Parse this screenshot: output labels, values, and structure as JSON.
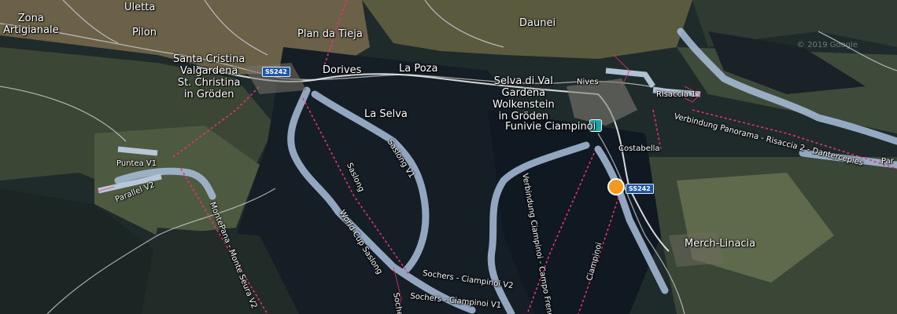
{
  "map": {
    "places": [
      {
        "id": "zona",
        "text": "Zona\nArtigianale"
      },
      {
        "id": "uletta",
        "text": "Uletta"
      },
      {
        "id": "pilon",
        "text": "Pilon"
      },
      {
        "id": "plan",
        "text": "Plan da Tieja"
      },
      {
        "id": "daunei",
        "text": "Daunei"
      },
      {
        "id": "santa",
        "text": "Santa Cristina\nValgardena\nSt. Christina\nin Gröden"
      },
      {
        "id": "dorives",
        "text": "Dorives"
      },
      {
        "id": "lapoza",
        "text": "La Poza"
      },
      {
        "id": "selvaval",
        "text": "Selva di Val\nGardena\nWolkenstein\nin Gröden"
      },
      {
        "id": "nives",
        "text": "Nives"
      },
      {
        "id": "laselva",
        "text": "La Selva"
      },
      {
        "id": "funivie",
        "text": "Funivie Ciampinoi"
      },
      {
        "id": "costabella",
        "text": "Costabella"
      },
      {
        "id": "merch",
        "text": "Merch-Linacia"
      }
    ],
    "pistes": [
      {
        "id": "risaccia1",
        "text": "Risaccia 1"
      },
      {
        "id": "verbpanorama",
        "text": "Verbindung Panorama - Risaccia 2 - Dantercepies"
      },
      {
        "id": "par",
        "text": "Par"
      },
      {
        "id": "puntea",
        "text": "Puntea V1"
      },
      {
        "id": "parallel",
        "text": "Parallel V2"
      },
      {
        "id": "montepana",
        "text": "MontePana - Monte Seura V2"
      },
      {
        "id": "saslong",
        "text": "Saslong"
      },
      {
        "id": "saslongv1",
        "text": "Saslong V1"
      },
      {
        "id": "worldcup",
        "text": "World Cup Saslong"
      },
      {
        "id": "verbciampinoi",
        "text": "Verbindung Ciampinoi - Campo Freno"
      },
      {
        "id": "ciampinoi",
        "text": "Ciampinoi"
      },
      {
        "id": "sochers2",
        "text": "Sochers - Ciampinoi V2"
      },
      {
        "id": "sochers1",
        "text": "Sochers - Ciampinoi V1"
      },
      {
        "id": "sochers",
        "text": "Socher"
      }
    ],
    "roads": [
      {
        "id": "ss242a",
        "text": "SS242"
      },
      {
        "id": "ss242b",
        "text": "SS242"
      }
    ],
    "copyright": "© 2019 Google",
    "icons": {
      "poi": "cable-car-icon",
      "home": "home-marker-icon"
    },
    "colors": {
      "piste": "#a9bfdc",
      "lift": "#e8336d",
      "road": "#cfd3d6"
    }
  }
}
